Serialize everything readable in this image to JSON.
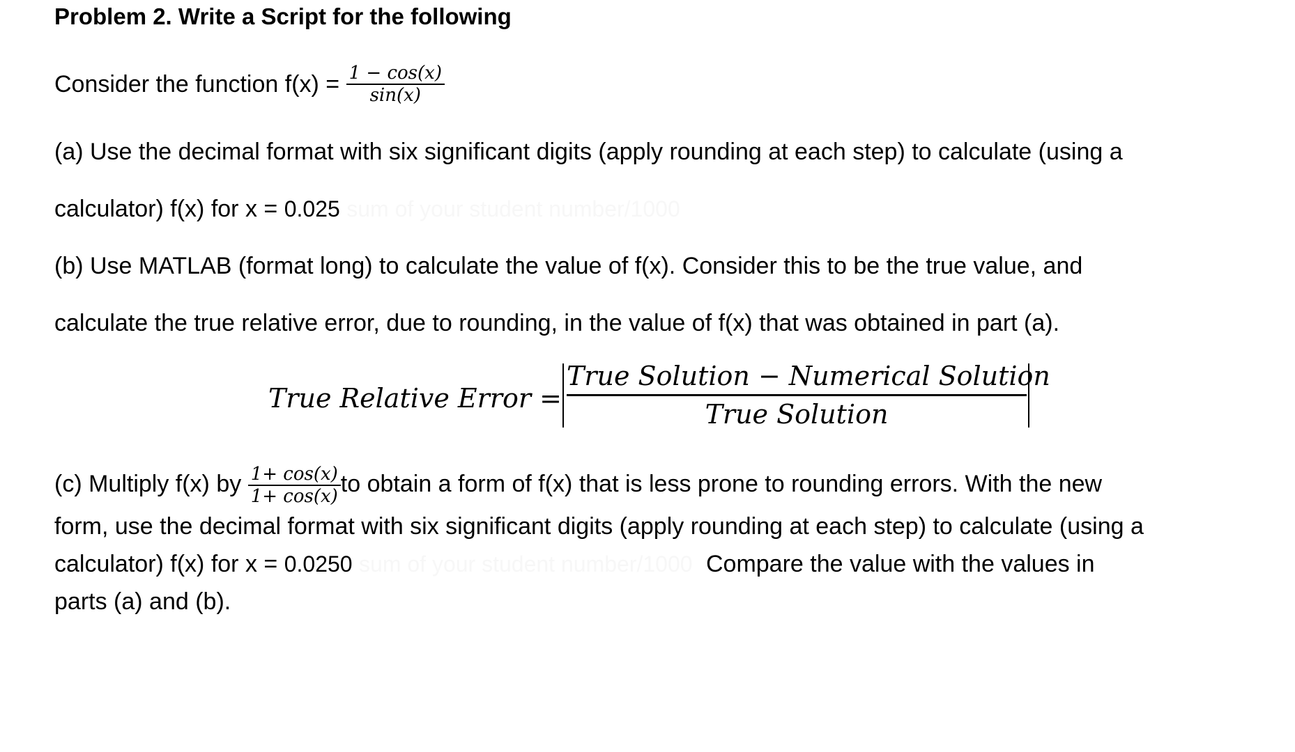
{
  "title": "Problem 2.  Write a Script for the following",
  "intro": {
    "text": "Consider the function f(x) = ",
    "numerator": "1 − cos(x)",
    "denominator": "sin(x)"
  },
  "part_a": {
    "line1": "(a) Use the decimal format with six significant digits (apply rounding at each step) to calculate (using a",
    "line2_prefix": "calculator) f(x) for x = ",
    "x_value": "0.025",
    "hidden_note": "sum of your student number/1000"
  },
  "part_b": {
    "line1": "(b) Use MATLAB (format long) to calculate the value of f(x). Consider this to be the true value, and",
    "line2": "calculate the true relative error, due to rounding, in the value of f(x) that was obtained in part (a)."
  },
  "error_formula": {
    "lhs": "True Relative Error =",
    "numerator": "True Solution − Numerical Solution",
    "denominator": "True Solution"
  },
  "part_c": {
    "prefix": "(c) Multiply f(x) by ",
    "mult_numerator": "1+ cos(x)",
    "mult_denominator": "1+ cos(x)",
    "line1_suffix": "to obtain a form of f(x) that is less prone to rounding errors. With the new",
    "line2": "form, use the decimal format with six significant digits (apply rounding at each step) to calculate (using a",
    "line3_prefix": "calculator) f(x) for x = ",
    "x_value": "0.0250",
    "hidden_note": "sum of your student number/1000",
    "line3_suffix": "Compare the value with the values in",
    "line4": "parts (a) and (b)."
  }
}
